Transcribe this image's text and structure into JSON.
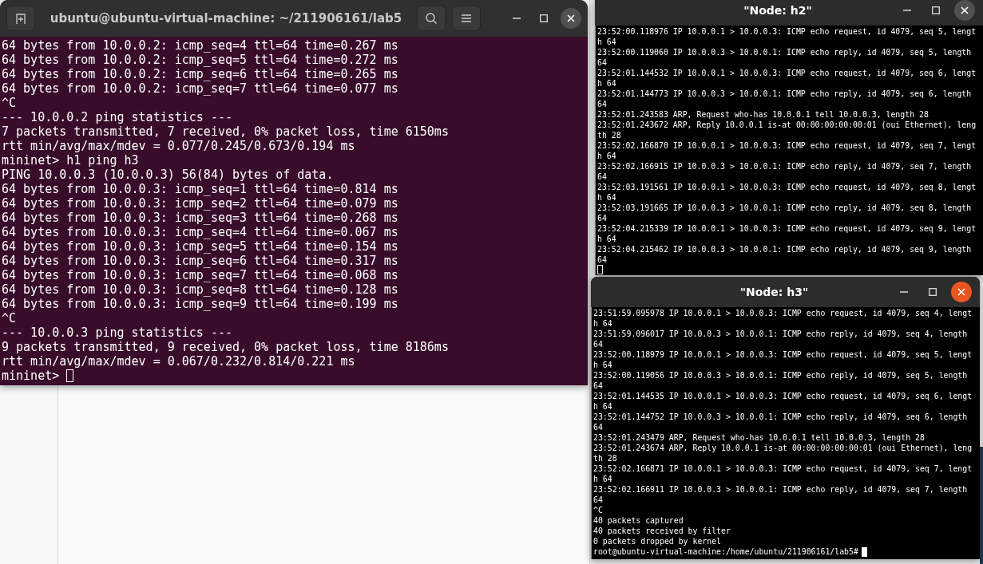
{
  "windows": [
    {
      "kind": "gnome-terminal",
      "title": "ubuntu@ubuntu-virtual-machine: ~/211906161/lab5",
      "focused": false,
      "lines": [
        "64 bytes from 10.0.0.2: icmp_seq=4 ttl=64 time=0.267 ms",
        "64 bytes from 10.0.0.2: icmp_seq=5 ttl=64 time=0.272 ms",
        "64 bytes from 10.0.0.2: icmp_seq=6 ttl=64 time=0.265 ms",
        "64 bytes from 10.0.0.2: icmp_seq=7 ttl=64 time=0.077 ms",
        "^C",
        "--- 10.0.0.2 ping statistics ---",
        "7 packets transmitted, 7 received, 0% packet loss, time 6150ms",
        "rtt min/avg/max/mdev = 0.077/0.245/0.673/0.194 ms",
        "mininet> h1 ping h3",
        "PING 10.0.0.3 (10.0.0.3) 56(84) bytes of data.",
        "64 bytes from 10.0.0.3: icmp_seq=1 ttl=64 time=0.814 ms",
        "64 bytes from 10.0.0.3: icmp_seq=2 ttl=64 time=0.079 ms",
        "64 bytes from 10.0.0.3: icmp_seq=3 ttl=64 time=0.268 ms",
        "64 bytes from 10.0.0.3: icmp_seq=4 ttl=64 time=0.067 ms",
        "64 bytes from 10.0.0.3: icmp_seq=5 ttl=64 time=0.154 ms",
        "64 bytes from 10.0.0.3: icmp_seq=6 ttl=64 time=0.317 ms",
        "64 bytes from 10.0.0.3: icmp_seq=7 ttl=64 time=0.068 ms",
        "64 bytes from 10.0.0.3: icmp_seq=8 ttl=64 time=0.128 ms",
        "64 bytes from 10.0.0.3: icmp_seq=9 ttl=64 time=0.199 ms",
        "^C",
        "--- 10.0.0.3 ping statistics ---",
        "9 packets transmitted, 9 received, 0% packet loss, time 8186ms",
        "rtt min/avg/max/mdev = 0.067/0.232/0.814/0.221 ms"
      ],
      "prompt": "mininet>"
    },
    {
      "kind": "xterm",
      "title": "\"Node: h2\"",
      "focused": false,
      "lines": [
        "23:52:00.118976 IP 10.0.0.1 > 10.0.0.3: ICMP echo request, id 4079, seq 5, lengt",
        "h 64",
        "23:52:00.119060 IP 10.0.0.3 > 10.0.0.1: ICMP echo reply, id 4079, seq 5, length",
        "64",
        "23:52:01.144532 IP 10.0.0.1 > 10.0.0.3: ICMP echo request, id 4079, seq 6, lengt",
        "h 64",
        "23:52:01.144773 IP 10.0.0.3 > 10.0.0.1: ICMP echo reply, id 4079, seq 6, length",
        "64",
        "23:52:01.243583 ARP, Request who-has 10.0.0.1 tell 10.0.0.3, length 28",
        "23:52:01.243672 ARP, Reply 10.0.0.1 is-at 00:00:00:00:00:01 (oui Ethernet), leng",
        "th 28",
        "23:52:02.166870 IP 10.0.0.1 > 10.0.0.3: ICMP echo request, id 4079, seq 7, lengt",
        "h 64",
        "23:52:02.166915 IP 10.0.0.3 > 10.0.0.1: ICMP echo reply, id 4079, seq 7, length",
        "64",
        "23:52:03.191561 IP 10.0.0.1 > 10.0.0.3: ICMP echo request, id 4079, seq 8, lengt",
        "h 64",
        "23:52:03.191665 IP 10.0.0.3 > 10.0.0.1: ICMP echo reply, id 4079, seq 8, length",
        "64",
        "23:52:04.215339 IP 10.0.0.1 > 10.0.0.3: ICMP echo request, id 4079, seq 9, lengt",
        "h 64",
        "23:52:04.215462 IP 10.0.0.3 > 10.0.0.1: ICMP echo reply, id 4079, seq 9, length",
        "64"
      ]
    },
    {
      "kind": "xterm",
      "title": "\"Node: h3\"",
      "focused": true,
      "lines": [
        "23:51:59.095978 IP 10.0.0.1 > 10.0.0.3: ICMP echo request, id 4079, seq 4, lengt",
        "h 64",
        "23:51:59.096017 IP 10.0.0.3 > 10.0.0.1: ICMP echo reply, id 4079, seq 4, length",
        "64",
        "23:52:00.118979 IP 10.0.0.1 > 10.0.0.3: ICMP echo request, id 4079, seq 5, lengt",
        "h 64",
        "23:52:00.119056 IP 10.0.0.3 > 10.0.0.1: ICMP echo reply, id 4079, seq 5, length",
        "64",
        "23:52:01.144535 IP 10.0.0.1 > 10.0.0.3: ICMP echo request, id 4079, seq 6, lengt",
        "h 64",
        "23:52:01.144752 IP 10.0.0.3 > 10.0.0.1: ICMP echo reply, id 4079, seq 6, length",
        "64",
        "23:52:01.243479 ARP, Request who-has 10.0.0.1 tell 10.0.0.3, length 28",
        "23:52:01.243674 ARP, Reply 10.0.0.1 is-at 00:00:00:00:00:01 (oui Ethernet), leng",
        "th 28",
        "23:52:02.166871 IP 10.0.0.1 > 10.0.0.3: ICMP echo request, id 4079, seq 7, lengt",
        "h 64",
        "23:52:02.166911 IP 10.0.0.3 > 10.0.0.1: ICMP echo reply, id 4079, seq 7, length",
        "64",
        "^C",
        "40 packets captured",
        "40 packets received by filter",
        "0 packets dropped by kernel"
      ],
      "prompt": "root@ubuntu-virtual-machine:/home/ubuntu/211906161/lab5#"
    }
  ]
}
